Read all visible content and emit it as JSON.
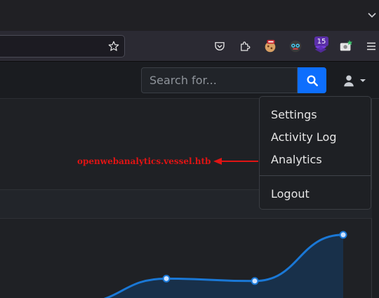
{
  "browser": {
    "extensions_badge": "15"
  },
  "header": {
    "search_placeholder": "Search for..."
  },
  "dropdown": {
    "items": [
      "Settings",
      "Activity Log",
      "Analytics"
    ],
    "logout": "Logout"
  },
  "annotation": {
    "text": "openwebanalytics.vessel.htb"
  },
  "colors": {
    "accent": "#0d6efd",
    "annotation": "#e01414",
    "chart_line": "#1a78d6"
  },
  "chart_data": {
    "type": "area",
    "x": [
      0,
      1,
      2,
      3
    ],
    "values": [
      0,
      1,
      0.9,
      2.8
    ],
    "visible_points": 3
  }
}
